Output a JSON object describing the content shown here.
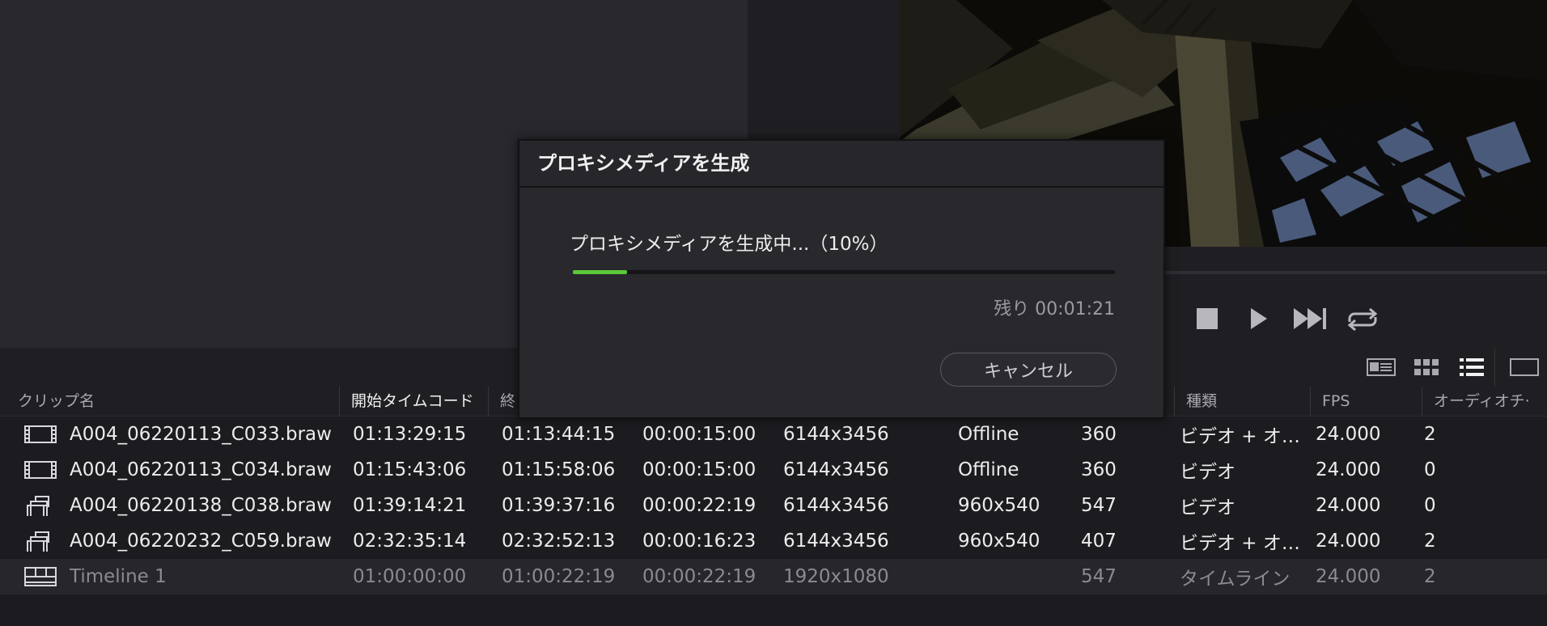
{
  "dialog": {
    "title": "プロキシメディアを生成",
    "message": "プロキシメディアを生成中...（10%）",
    "progress_fraction": 0.1,
    "remaining": "残り 00:01:21",
    "cancel_label": "キャンセル"
  },
  "table": {
    "columns": [
      "クリップ名",
      "開始タイムコード",
      "終",
      "",
      "",
      "",
      "",
      "種類",
      "FPS",
      "オーディオチ‧"
    ],
    "rows": [
      {
        "icon": "video-clip-icon",
        "name": "A004_06220113_C033.braw",
        "start_tc": "01:13:29:15",
        "end_tc": "01:13:44:15",
        "duration": "00:00:15:00",
        "resolution": "6144x3456",
        "proxy": "Offline",
        "frames": "360",
        "type": "ビデオ + オ…",
        "fps": "24.000",
        "audio_ch": "2"
      },
      {
        "icon": "video-clip-icon",
        "name": "A004_06220113_C034.braw",
        "start_tc": "01:15:43:06",
        "end_tc": "01:15:58:06",
        "duration": "00:00:15:00",
        "resolution": "6144x3456",
        "proxy": "Offline",
        "frames": "360",
        "type": "ビデオ",
        "fps": "24.000",
        "audio_ch": "0"
      },
      {
        "icon": "proxy-clip-icon",
        "name": "A004_06220138_C038.braw",
        "start_tc": "01:39:14:21",
        "end_tc": "01:39:37:16",
        "duration": "00:00:22:19",
        "resolution": "6144x3456",
        "proxy": "960x540",
        "frames": "547",
        "type": "ビデオ",
        "fps": "24.000",
        "audio_ch": "0"
      },
      {
        "icon": "proxy-clip-icon",
        "name": "A004_06220232_C059.braw",
        "start_tc": "02:32:35:14",
        "end_tc": "02:32:52:13",
        "duration": "00:00:16:23",
        "resolution": "6144x3456",
        "proxy": "960x540",
        "frames": "407",
        "type": "ビデオ + オ…",
        "fps": "24.000",
        "audio_ch": "2"
      },
      {
        "icon": "timeline-icon",
        "name": "Timeline 1",
        "start_tc": "01:00:00:00",
        "end_tc": "01:00:22:19",
        "duration": "00:00:22:19",
        "resolution": "1920x1080",
        "proxy": "",
        "frames": "547",
        "type": "タイムライン",
        "fps": "24.000",
        "audio_ch": "2"
      }
    ]
  },
  "transport": [
    "stop-icon",
    "play-icon",
    "next-clip-icon",
    "loop-icon"
  ],
  "view_modes": [
    "metadata-view-icon",
    "thumbnail-view-icon",
    "list-view-icon",
    "single-viewer-icon"
  ],
  "colors": {
    "accent_progress": "#5ac83a",
    "dialog_bg": "#28282d",
    "panel_bg": "#1f1f23"
  }
}
